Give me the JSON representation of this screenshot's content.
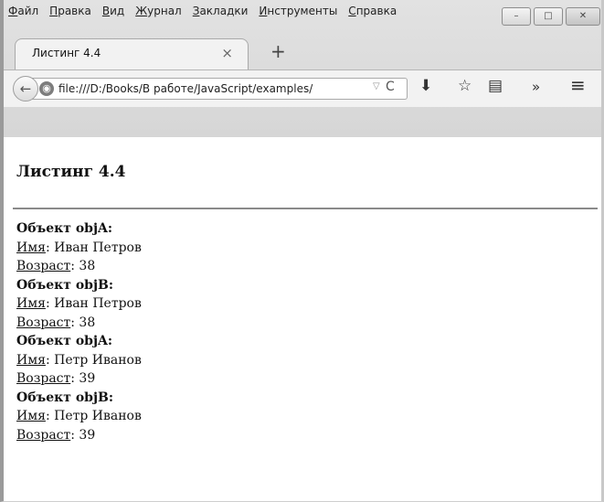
{
  "menu": [
    "Файл",
    "Правка",
    "Вид",
    "Журнал",
    "Закладки",
    "Инструменты",
    "Справка"
  ],
  "window_buttons": {
    "minimize": "–",
    "maximize": "□",
    "close": "✕"
  },
  "tab": {
    "title": "Листинг 4.4",
    "close": "×"
  },
  "new_tab": "+",
  "nav": {
    "back": "←",
    "url": "file:///D:/Books/В работе/JavaScript/examples/",
    "dropdown": "▽",
    "reload": "C",
    "download": "⬇",
    "bookmark": "☆",
    "reader": "▤",
    "more": "»",
    "hamburger": "≡"
  },
  "page": {
    "heading": "Листинг 4.4",
    "blocks": [
      {
        "header": "Объект objA:",
        "name_label": "Имя",
        "name": "Иван Петров",
        "age_label": "Возраст",
        "age": "38"
      },
      {
        "header": "Объект objB:",
        "name_label": "Имя",
        "name": "Иван Петров",
        "age_label": "Возраст",
        "age": "38"
      },
      {
        "header": "Объект objA:",
        "name_label": "Имя",
        "name": "Петр Иванов",
        "age_label": "Возраст",
        "age": "39"
      },
      {
        "header": "Объект objB:",
        "name_label": "Имя",
        "name": "Петр Иванов",
        "age_label": "Возраст",
        "age": "39"
      }
    ]
  }
}
